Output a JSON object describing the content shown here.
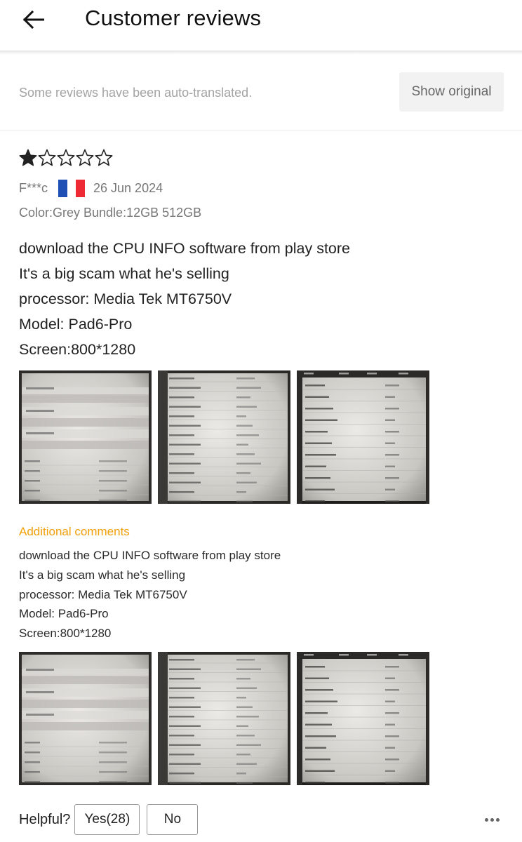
{
  "header": {
    "title": "Customer reviews",
    "back_icon": "arrow-left-icon"
  },
  "notice": {
    "text": "Some reviews have been auto-translated.",
    "show_original_label": "Show original"
  },
  "review": {
    "rating": 1,
    "rating_max": 5,
    "reviewer": "F***c",
    "country_flag": "france-flag-icon",
    "flag_colors": [
      "#1f4fb4",
      "#ffffff",
      "#ee2a35"
    ],
    "date": "26 Jun 2024",
    "variant": "Color:Grey Bundle:12GB 512GB",
    "text_lines": [
      "download the CPU INFO software from play store",
      "It's a big scam what he's selling",
      "processor: Media Tek MT6750V",
      "Model: Pad6-Pro",
      "Screen:800*1280"
    ],
    "additional": {
      "label": "Additional comments",
      "text_lines": [
        "download the CPU INFO software from play store",
        "It's a big scam what he's selling",
        "processor: Media Tek MT6750V",
        "Model: Pad6-Pro",
        "Screen:800*1280"
      ]
    }
  },
  "helpful": {
    "label": "Helpful?",
    "yes_label": "Yes(28)",
    "no_label": "No",
    "more_icon": "more-horizontal-icon"
  },
  "colors": {
    "accent_orange": "#f2a00a",
    "star": "#222222"
  }
}
